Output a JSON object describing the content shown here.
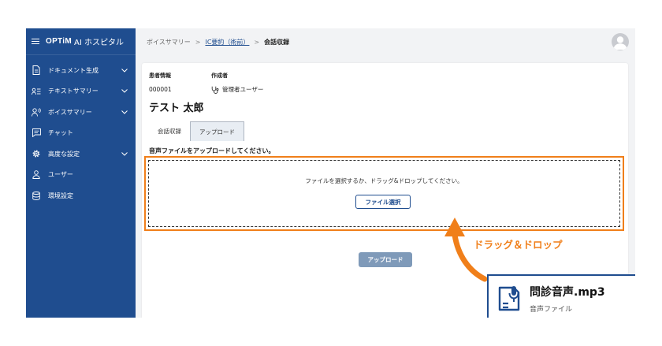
{
  "brand": {
    "optim": "OPTiM",
    "product": "AI ホスピタル"
  },
  "sidebar": {
    "items": [
      {
        "label": "ドキュメント生成",
        "icon": "document-icon",
        "expandable": true
      },
      {
        "label": "テキストサマリー",
        "icon": "text-list-icon",
        "expandable": true
      },
      {
        "label": "ボイスサマリー",
        "icon": "voice-user-icon",
        "expandable": true
      },
      {
        "label": "チャット",
        "icon": "chat-icon",
        "expandable": false
      },
      {
        "label": "高度な設定",
        "icon": "gear-icon",
        "expandable": true
      },
      {
        "label": "ユーザー",
        "icon": "user-icon",
        "expandable": false
      },
      {
        "label": "環境設定",
        "icon": "database-icon",
        "expandable": false
      }
    ]
  },
  "breadcrumb": {
    "items": [
      "ボイスサマリー",
      "IC要約（術前）",
      "会話収録"
    ],
    "separator": ">"
  },
  "patient": {
    "info_label": "患者情報",
    "id": "000001",
    "name": "テスト 太郎",
    "author_label": "作成者",
    "author": "管理者ユーザー"
  },
  "tabs": [
    {
      "label": "会話収録",
      "active": false
    },
    {
      "label": "アップロード",
      "active": true
    }
  ],
  "upload": {
    "instruction": "音声ファイルをアップロードしてください。",
    "drop_text": "ファイルを選択するか、ドラッグ&ドロップしてください。",
    "select_button": "ファイル選択",
    "upload_button": "アップロード"
  },
  "overlay": {
    "dnd_label": "ドラッグ＆ドロップ",
    "file_name": "問診音声.mp3",
    "file_type": "音声ファイル"
  },
  "colors": {
    "sidebar": "#1f4d8f",
    "accent": "#f07f1a",
    "upload_disabled": "#7f9ab9"
  }
}
